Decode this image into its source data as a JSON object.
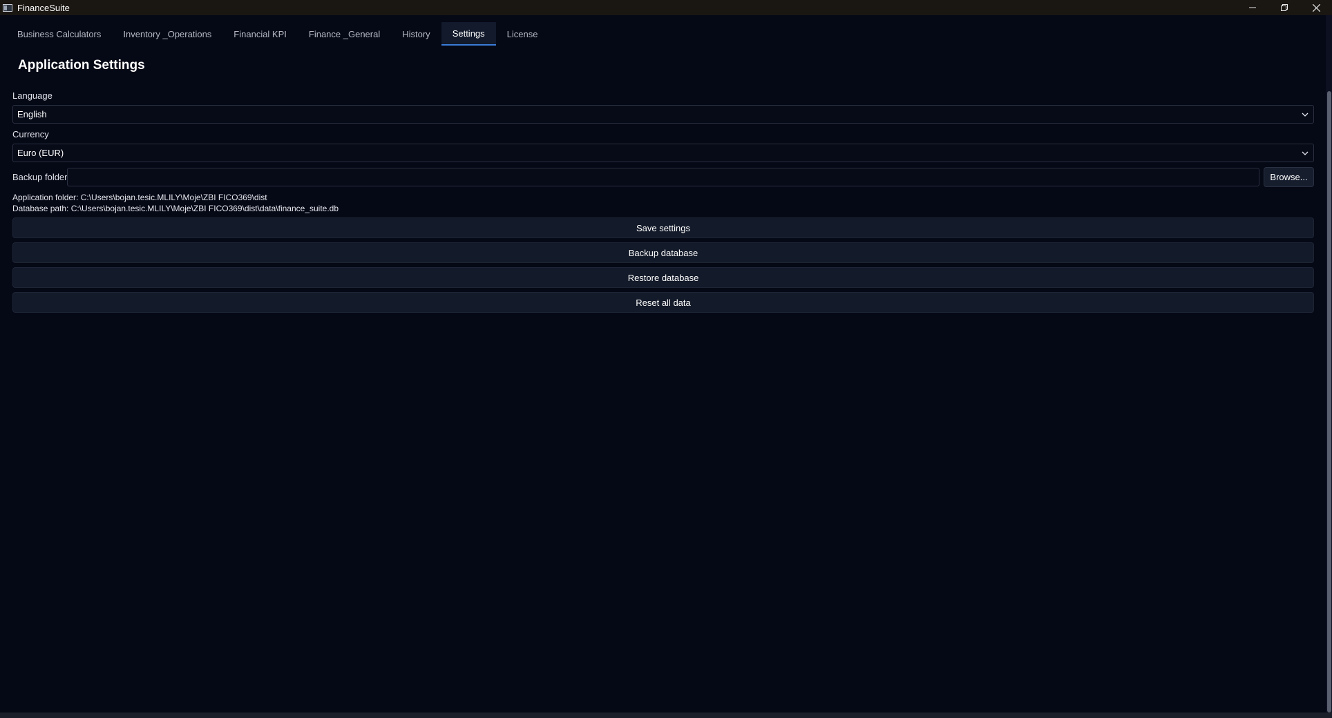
{
  "window": {
    "title": "FinanceSuite",
    "controls": {
      "minimize": "minimize-icon",
      "maximize": "restore-icon",
      "close": "close-icon"
    }
  },
  "tabs": [
    {
      "label": "Business Calculators",
      "active": false
    },
    {
      "label": "Inventory _Operations",
      "active": false
    },
    {
      "label": "Financial KPI",
      "active": false
    },
    {
      "label": "Finance _General",
      "active": false
    },
    {
      "label": "History",
      "active": false
    },
    {
      "label": "Settings",
      "active": true
    },
    {
      "label": "License",
      "active": false
    }
  ],
  "settings": {
    "heading": "Application Settings",
    "language": {
      "label": "Language",
      "value": "English"
    },
    "currency": {
      "label": "Currency",
      "value": "Euro (EUR)"
    },
    "backup_folder": {
      "label": "Backup folder",
      "value": "",
      "browse_label": "Browse..."
    },
    "app_folder": "Application folder: C:\\Users\\bojan.tesic.MLILY\\Moje\\ZBI FICO369\\dist",
    "db_path": "Database path: C:\\Users\\bojan.tesic.MLILY\\Moje\\ZBI FICO369\\dist\\data\\finance_suite.db",
    "buttons": {
      "save": "Save settings",
      "backup": "Backup database",
      "restore": "Restore database",
      "reset": "Reset all data"
    }
  },
  "colors": {
    "background": "#050815",
    "titlebar": "#1a1612",
    "accent": "#3b7bd8",
    "button": "#131a29"
  }
}
